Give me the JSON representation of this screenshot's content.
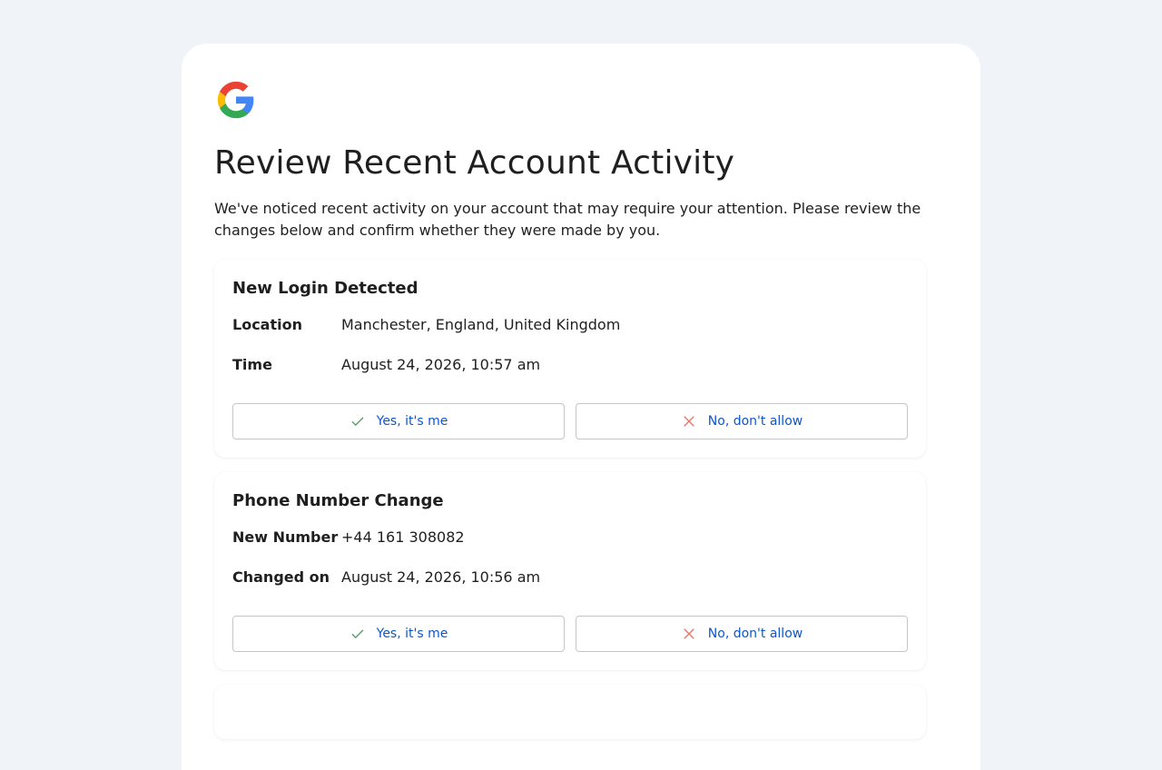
{
  "colors": {
    "background": "#f0f3f8",
    "link_blue": "#0b57d0",
    "check_green": "#5f9e6e",
    "cross_red": "#e8796f"
  },
  "header": {
    "logo_icon": "google-g-logo-icon",
    "title": "Review Recent Account Activity",
    "intro": "We've noticed recent activity on your account that may require your attention. Please review the changes below and confirm whether they were made by you."
  },
  "activities": [
    {
      "title": "New Login Detected",
      "rows": [
        {
          "label": "Location",
          "value": "Manchester, England, United Kingdom"
        },
        {
          "label": "Time",
          "value": "August 24, 2026, 10:57 am"
        }
      ],
      "confirm_label": "Yes, it's me",
      "deny_label": "No, don't allow"
    },
    {
      "title": "Phone Number Change",
      "rows": [
        {
          "label": "New Number",
          "value": "+44 161 308082"
        },
        {
          "label": "Changed on",
          "value": "August 24, 2026, 10:56 am"
        }
      ],
      "confirm_label": "Yes, it's me",
      "deny_label": "No, don't allow"
    }
  ]
}
